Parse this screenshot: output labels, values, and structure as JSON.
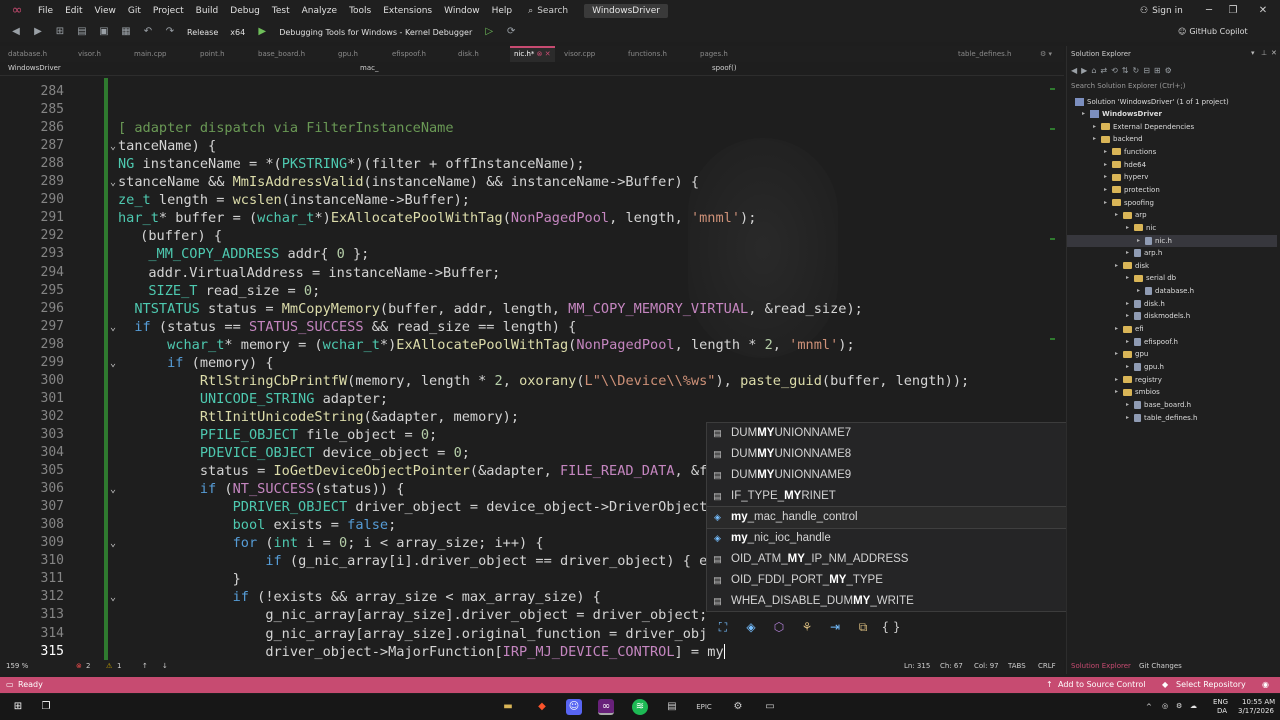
{
  "menubar": {
    "items": [
      "File",
      "Edit",
      "View",
      "Git",
      "Project",
      "Build",
      "Debug",
      "Test",
      "Analyze",
      "Tools",
      "Extensions",
      "Window",
      "Help"
    ],
    "search_label": "Search",
    "solution_title": "WindowsDriver",
    "signin": "Sign in"
  },
  "toolbar": {
    "config": "Release",
    "platform": "x64",
    "debugger": "Debugging Tools for Windows - Kernel Debugger",
    "copilot": "GitHub Copilot"
  },
  "tabs": [
    {
      "label": "database.h"
    },
    {
      "label": "visor.h"
    },
    {
      "label": "main.cpp"
    },
    {
      "label": "point.h"
    },
    {
      "label": "base_board.h"
    },
    {
      "label": "gpu.h"
    },
    {
      "label": "efispoof.h"
    },
    {
      "label": "disk.h"
    },
    {
      "label": "nic.h*",
      "active": true
    },
    {
      "label": "visor.cpp"
    },
    {
      "label": "functions.h"
    },
    {
      "label": "pages.h"
    },
    {
      "label": "table_defines.h"
    }
  ],
  "navbar": {
    "project": "WindowsDriver",
    "scope": "mac_",
    "member": "spoof()"
  },
  "editor": {
    "line_numbers": [
      "284",
      "285",
      "286",
      "287",
      "288",
      "289",
      "290",
      "291",
      "292",
      "293",
      "294",
      "295",
      "296",
      "297",
      "298",
      "299",
      "300",
      "301",
      "302",
      "303",
      "304",
      "305",
      "306",
      "307",
      "308",
      "309",
      "310",
      "311",
      "312",
      "313",
      "314",
      "315"
    ],
    "current_line": "315",
    "lines": [
      "",
      "",
      "[ adapter dispatch via FilterInstanceName",
      "tanceName) {",
      "NG instanceName = *(PKSTRING*)(filter + offInstanceName);",
      "stanceName && MmIsAddressValid(instanceName) && instanceName->Buffer) {",
      "ze_t length = wcslen(instanceName->Buffer);",
      "har_t* buffer = (wchar_t*)ExAllocatePoolWithTag(NonPagedPool, length, 'mnml');",
      " (buffer) {",
      "  _MM_COPY_ADDRESS addr{ 0 };",
      "  addr.VirtualAddress = instanceName->Buffer;",
      "  SIZE_T read_size = 0;",
      "  NTSTATUS status = MmCopyMemory(buffer, addr, length, MM_COPY_MEMORY_VIRTUAL, &read_size);",
      "  if (status == STATUS_SUCCESS && read_size == length) {",
      "      wchar_t* memory = (wchar_t*)ExAllocatePoolWithTag(NonPagedPool, length * 2, 'mnml');",
      "      if (memory) {",
      "          RtlStringCbPrintfW(memory, length * 2, oxorany(L\"\\\\Device\\\\%ws\"), paste_guid(buffer, length));",
      "          UNICODE_STRING adapter;",
      "          RtlInitUnicodeString(&adapter, memory);",
      "          PFILE_OBJECT file_object = 0;",
      "          PDEVICE_OBJECT device_object = 0;",
      "          status = IoGetDeviceObjectPointer(&adapter, FILE_READ_DATA, &f",
      "          if (NT_SUCCESS(status)) {",
      "              PDRIVER_OBJECT driver_object = device_object->DriverObject",
      "              bool exists = false;",
      "              for (int i = 0; i < array_size; i++) {",
      "                  if (g_nic_array[i].driver_object == driver_object) { e",
      "              }",
      "              if (!exists && array_size < max_array_size) {",
      "                  g_nic_array[array_size].driver_object = driver_object;",
      "                  g_nic_array[array_size].original_function = driver_obj",
      "                  driver_object->MajorFunction[IRP_MJ_DEVICE_CONTROL] = my"
    ]
  },
  "suggestions": {
    "items": [
      {
        "pre": "DUM",
        "match": "MY",
        "post": "UNIONNAME7",
        "icon": "enum-icon"
      },
      {
        "pre": "DUM",
        "match": "MY",
        "post": "UNIONNAME8",
        "icon": "enum-icon"
      },
      {
        "pre": "DUM",
        "match": "MY",
        "post": "UNIONNAME9",
        "icon": "enum-icon"
      },
      {
        "pre": "IF_TYPE_",
        "match": "MY",
        "post": "RINET",
        "icon": "enum-icon"
      },
      {
        "pre": "",
        "match": "my",
        "post": "_mac_handle_control",
        "icon": "method-icon",
        "selected": true
      },
      {
        "pre": "",
        "match": "my",
        "post": "_nic_ioc_handle",
        "icon": "method-icon"
      },
      {
        "pre": "OID_ATM_",
        "match": "MY",
        "post": "_IP_NM_ADDRESS",
        "icon": "enum-icon"
      },
      {
        "pre": "OID_FDDI_PORT_",
        "match": "MY",
        "post": "_TYPE",
        "icon": "enum-icon"
      },
      {
        "pre": "WHEA_DISABLE_DUM",
        "match": "MY",
        "post": "_WRITE",
        "icon": "enum-icon"
      }
    ]
  },
  "editor_status": {
    "zoom": "159 %",
    "errors": "2",
    "warnings": "1",
    "ln": "Ln: 315",
    "ch": "Ch: 67",
    "col": "Col: 97",
    "tabs": "TABS",
    "eol": "CRLF"
  },
  "solution_explorer": {
    "title": "Solution Explorer",
    "search_placeholder": "Search Solution Explorer (Ctrl+;)",
    "solution": "Solution 'WindowsDriver' (1 of 1 project)",
    "tree": [
      {
        "label": "WindowsDriver",
        "depth": 1,
        "kind": "project",
        "bold": true
      },
      {
        "label": "External Dependencies",
        "depth": 2,
        "kind": "folder"
      },
      {
        "label": "backend",
        "depth": 2,
        "kind": "folder"
      },
      {
        "label": "functions",
        "depth": 3,
        "kind": "folder"
      },
      {
        "label": "hde64",
        "depth": 3,
        "kind": "folder"
      },
      {
        "label": "hyperv",
        "depth": 3,
        "kind": "folder"
      },
      {
        "label": "protection",
        "depth": 3,
        "kind": "folder"
      },
      {
        "label": "spoofing",
        "depth": 3,
        "kind": "folder"
      },
      {
        "label": "arp",
        "depth": 4,
        "kind": "folder"
      },
      {
        "label": "nic",
        "depth": 5,
        "kind": "folder"
      },
      {
        "label": "nic.h",
        "depth": 6,
        "kind": "file",
        "selected": true
      },
      {
        "label": "arp.h",
        "depth": 5,
        "kind": "file"
      },
      {
        "label": "disk",
        "depth": 4,
        "kind": "folder"
      },
      {
        "label": "serial db",
        "depth": 5,
        "kind": "folder"
      },
      {
        "label": "database.h",
        "depth": 6,
        "kind": "file"
      },
      {
        "label": "disk.h",
        "depth": 5,
        "kind": "file"
      },
      {
        "label": "diskmodels.h",
        "depth": 5,
        "kind": "file"
      },
      {
        "label": "efi",
        "depth": 4,
        "kind": "folder"
      },
      {
        "label": "efispoof.h",
        "depth": 5,
        "kind": "file"
      },
      {
        "label": "gpu",
        "depth": 4,
        "kind": "folder"
      },
      {
        "label": "gpu.h",
        "depth": 5,
        "kind": "file"
      },
      {
        "label": "registry",
        "depth": 4,
        "kind": "folder"
      },
      {
        "label": "smbios",
        "depth": 4,
        "kind": "folder"
      },
      {
        "label": "base_board.h",
        "depth": 5,
        "kind": "file"
      },
      {
        "label": "table_defines.h",
        "depth": 5,
        "kind": "file"
      }
    ],
    "bottom_tabs": [
      "Solution Explorer",
      "Git Changes"
    ]
  },
  "statusbar": {
    "ready": "Ready",
    "add_source": "Add to Source Control",
    "select_repo": "Select Repository"
  },
  "taskbar": {
    "lang": "ENG",
    "region": "DA",
    "time": "10:55 AM",
    "date": "3/17/2026"
  },
  "colors": {
    "accent": "#c74b71",
    "editor_bg": "#1e1e1e",
    "keyword": "#569cd6",
    "type": "#4ec9b0",
    "function": "#dcdcaa"
  }
}
